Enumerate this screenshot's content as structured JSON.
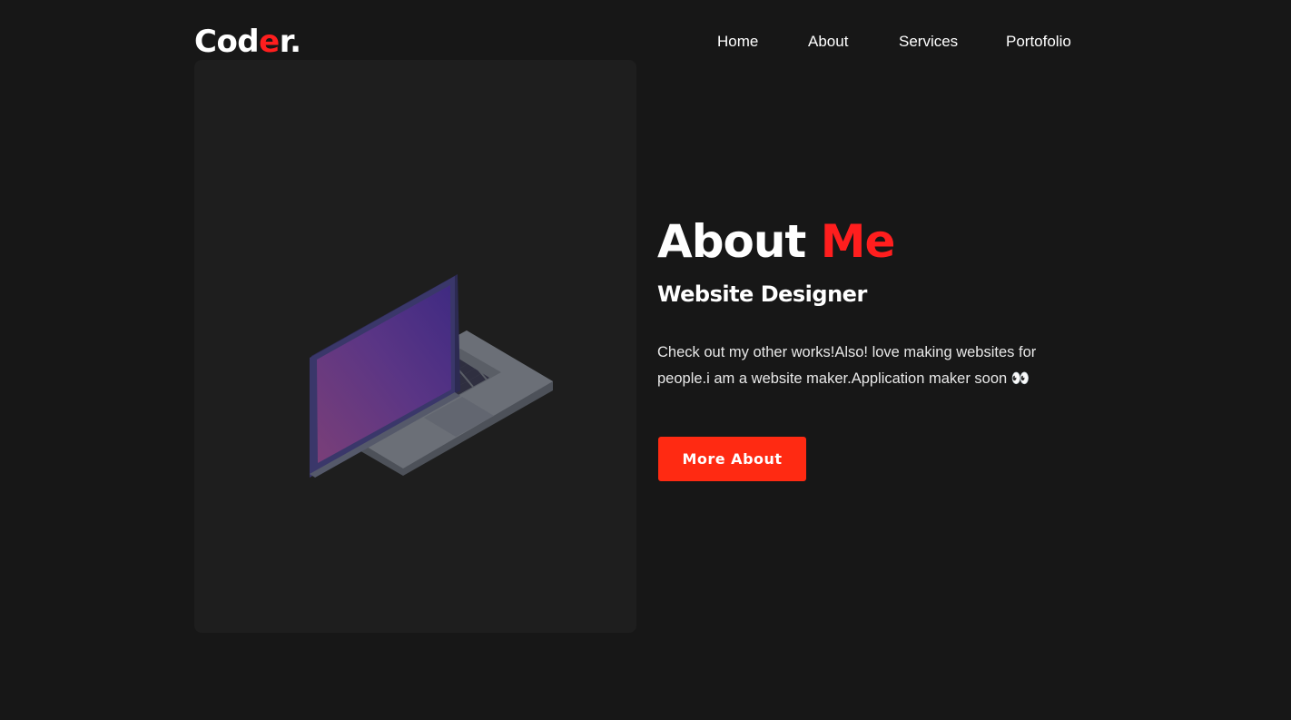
{
  "header": {
    "logo_part1": "Cod",
    "logo_accent": "e",
    "logo_part2": "r.",
    "nav": {
      "home": "Home",
      "about": "About",
      "services": "Services",
      "portfolio": "Portofolio"
    }
  },
  "about": {
    "title_main": "About",
    "title_accent": "Me",
    "subtitle": "Website Designer",
    "description": "Check out my other works!Also! love making websites for people.i am a website maker.Application maker soon 👀",
    "button_label": "More About"
  },
  "image": {
    "icon": "laptop-icon"
  },
  "colors": {
    "background": "#171717",
    "card": "#1e1e1e",
    "accent": "#ff1e1e",
    "button": "#ff2a12",
    "text": "#ffffff"
  }
}
